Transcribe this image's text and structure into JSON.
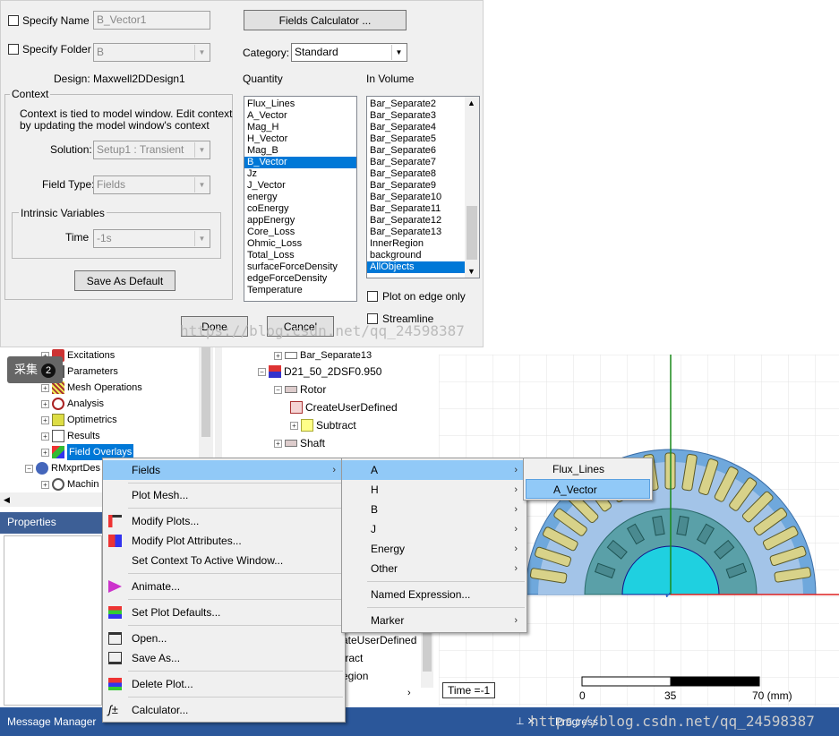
{
  "dialog": {
    "specify_name": "Specify Name",
    "name_value": "B_Vector1",
    "specify_folder": "Specify Folder",
    "folder_value": "B",
    "design_label": "Design:",
    "design_value": "Maxwell2DDesign1",
    "context_title": "Context",
    "context_text1": "Context is tied to model window. Edit context",
    "context_text2": "by updating the model window's context",
    "solution_label": "Solution:",
    "solution_value": "Setup1 : Transient",
    "fieldtype_label": "Field Type:",
    "fieldtype_value": "Fields",
    "intrinsic_title": "Intrinsic Variables",
    "time_label": "Time",
    "time_value": "-1s",
    "save_default": "Save As Default",
    "fields_calc": "Fields Calculator ...",
    "category_label": "Category:",
    "category_value": "Standard",
    "quantity_label": "Quantity",
    "involume_label": "In Volume",
    "quantities": [
      "Flux_Lines",
      "A_Vector",
      "Mag_H",
      "H_Vector",
      "Mag_B",
      "B_Vector",
      "Jz",
      "J_Vector",
      "energy",
      "coEnergy",
      "appEnergy",
      "Core_Loss",
      "Ohmic_Loss",
      "Total_Loss",
      "surfaceForceDensity",
      "edgeForceDensity",
      "Temperature"
    ],
    "volumes": [
      "Bar_Separate2",
      "Bar_Separate3",
      "Bar_Separate4",
      "Bar_Separate5",
      "Bar_Separate6",
      "Bar_Separate7",
      "Bar_Separate8",
      "Bar_Separate9",
      "Bar_Separate10",
      "Bar_Separate11",
      "Bar_Separate12",
      "Bar_Separate13",
      "InnerRegion",
      "background",
      "AllObjects"
    ],
    "plot_edge": "Plot on edge only",
    "streamline": "Streamline",
    "done": "Done",
    "cancel": "Cancel",
    "watermark": "https://blog.csdn.net/qq_24598387"
  },
  "tree": {
    "left_items": [
      "Excitations",
      "Parameters",
      "Mesh Operations",
      "Analysis",
      "Optimetrics",
      "Results",
      "Field Overlays",
      "RMxprtDes",
      "Machin"
    ],
    "right_items": [
      "Bar_Separate13",
      "D21_50_2DSF0.950",
      "Rotor",
      "CreateUserDefined",
      "Subtract",
      "Shaft"
    ],
    "right_lower": [
      "ateUserDefined",
      "tract",
      "egion"
    ],
    "collect_badge": "采集",
    "badge_num": "2",
    "properties": "Properties"
  },
  "menu1": [
    "Fields",
    "Plot Mesh...",
    "Modify Plots...",
    "Modify Plot Attributes...",
    "Set Context To Active Window...",
    "Animate...",
    "Set Plot Defaults...",
    "Open...",
    "Save As...",
    "Delete Plot...",
    "Calculator..."
  ],
  "menu2": [
    "A",
    "H",
    "B",
    "J",
    "Energy",
    "Other",
    "Named Expression...",
    "Marker"
  ],
  "menu3": [
    "Flux_Lines",
    "A_Vector"
  ],
  "view": {
    "time": "Time =-1",
    "scale": [
      "0",
      "35",
      "70 (mm)"
    ]
  },
  "status": {
    "message": "Message Manager",
    "progress": "Progress",
    "watermark": "https://blog.csdn.net/qq_24598387"
  }
}
